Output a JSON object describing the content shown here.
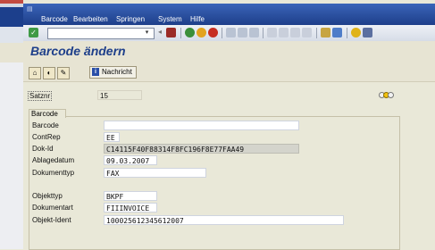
{
  "menu": {
    "barcode": "Barcode",
    "bearbeiten": "Bearbeiten",
    "springen": "Springen",
    "system": "System",
    "hilfe": "Hilfe"
  },
  "title": "Barcode ändern",
  "appbar": {
    "nachricht": "Nachricht"
  },
  "header": {
    "satznr_label": "Satznr",
    "satznr_value": "15"
  },
  "group_title": "Barcode",
  "fields": {
    "barcode": {
      "label": "Barcode",
      "value": ""
    },
    "contrep": {
      "label": "ContRep",
      "value": "EE"
    },
    "dokid": {
      "label": "Dok-Id",
      "value": "C14115F40F88314F8FC196F8E77FAA49"
    },
    "ablagedatum": {
      "label": "Ablagedatum",
      "value": "09.03.2007"
    },
    "dokumenttyp": {
      "label": "Dokumenttyp",
      "value": "FAX"
    },
    "objekttyp": {
      "label": "Objekttyp",
      "value": "BKPF"
    },
    "dokumentart": {
      "label": "Dokumentart",
      "value": "FIIINVOICE"
    },
    "objektident": {
      "label": "Objekt-Ident",
      "value": "100025612345612007"
    }
  },
  "icons": {
    "enter": "enter-check-icon",
    "save": "save-icon",
    "back": "back-icon",
    "exit": "exit-icon",
    "cancel": "cancel-icon",
    "print": "print-icon",
    "find": "find-icon",
    "help": "help-icon",
    "status": "status-lights-icon"
  }
}
